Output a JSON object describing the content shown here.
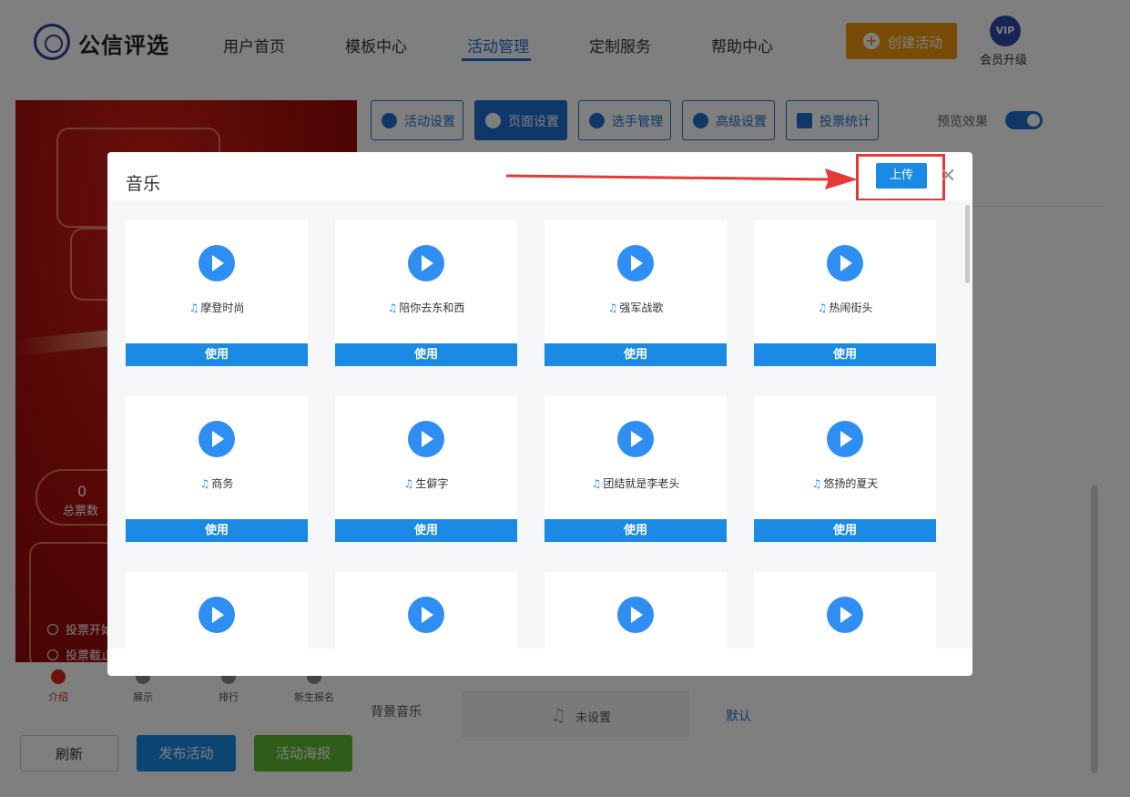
{
  "header": {
    "brand": "公信评选",
    "nav": [
      {
        "label": "用户首页"
      },
      {
        "label": "模板中心"
      },
      {
        "label": "活动管理",
        "active": true
      },
      {
        "label": "定制服务"
      },
      {
        "label": "帮助中心"
      }
    ],
    "create_label": "创建活动",
    "vip_badge": "VIP",
    "vip_label": "会员升级"
  },
  "preview": {
    "total_votes_value": "0",
    "total_votes_label": "总票数",
    "vote_start": "投票开始",
    "vote_end": "投票截止",
    "tabs": [
      {
        "label": "介绍",
        "active": true
      },
      {
        "label": "展示"
      },
      {
        "label": "排行"
      },
      {
        "label": "新生报名"
      }
    ]
  },
  "actions": {
    "refresh": "刷新",
    "publish": "发布活动",
    "poster": "活动海报"
  },
  "settings_tabs": [
    {
      "label": "活动设置",
      "icon": "star-icon"
    },
    {
      "label": "页面设置",
      "icon": "flower-icon",
      "active": true
    },
    {
      "label": "选手管理",
      "icon": "users-icon"
    },
    {
      "label": "高级设置",
      "icon": "gear-list-icon"
    },
    {
      "label": "投票统计",
      "icon": "bar-chart-icon"
    }
  ],
  "preview_toggle": {
    "label": "预览效果",
    "on": true
  },
  "bgm": {
    "label": "背景音乐",
    "value": "未设置",
    "default_link": "默认"
  },
  "modal": {
    "title": "音乐",
    "upload_label": "上传",
    "use_label": "使用",
    "tracks": [
      "摩登时尚",
      "陪你去东和西",
      "强军战歌",
      "热闹街头",
      "商务",
      "生僻字",
      "团结就是李老头",
      "悠扬的夏天",
      "",
      "",
      "",
      ""
    ]
  },
  "colors": {
    "primary": "#1a8ae5",
    "nav_active": "#1f6fd1",
    "create": "#f0960f",
    "poster": "#5fb832",
    "highlight": "#e53935"
  }
}
